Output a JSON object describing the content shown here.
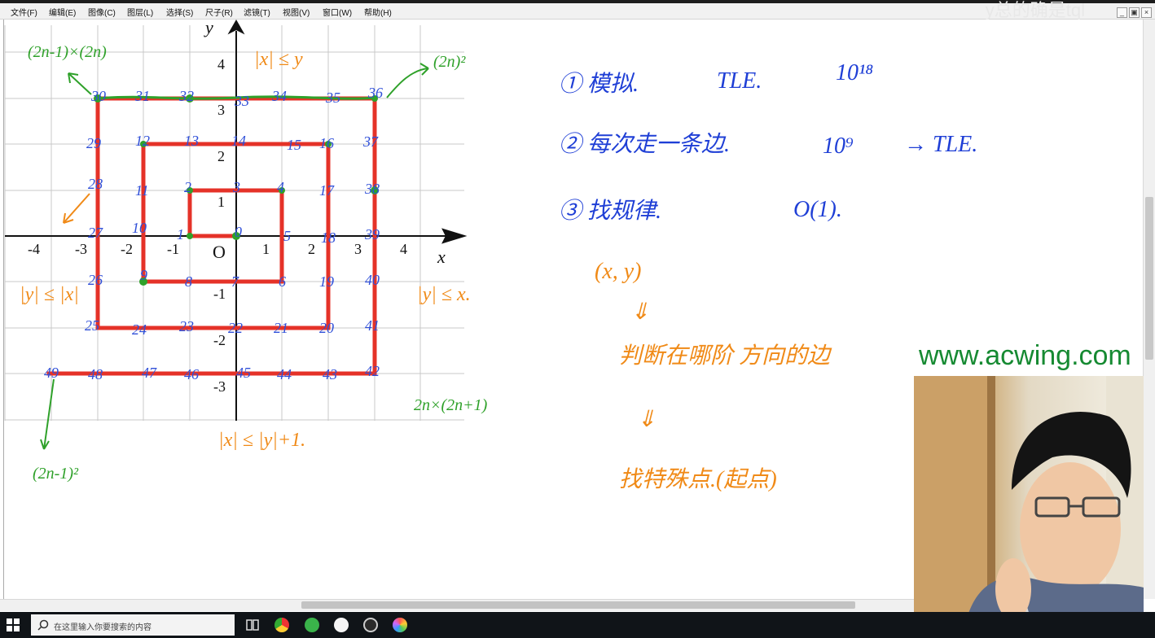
{
  "app": {
    "menu": [
      "文件(F)",
      "编辑(E)",
      "图像(C)",
      "图层(L)",
      "选择(S)",
      "尺子(R)",
      "滤镜(T)",
      "视图(V)",
      "窗口(W)",
      "帮助(H)"
    ],
    "user_overlay": "y总的确是tql",
    "window_buttons": [
      "_",
      "▣",
      "×"
    ]
  },
  "graph": {
    "x_axis_label": "x",
    "y_axis_label": "y",
    "origin_label": "O",
    "x_ticks": [
      "-4",
      "-3",
      "-2",
      "-1",
      "1",
      "2",
      "3",
      "4"
    ],
    "y_ticks": [
      "4",
      "3",
      "2",
      "1",
      "-1",
      "-2",
      "-3"
    ],
    "spiral_numbers": [
      "0",
      "1",
      "2",
      "3",
      "4",
      "5",
      "6",
      "7",
      "8",
      "9",
      "10",
      "11",
      "12",
      "13",
      "14",
      "15",
      "16",
      "17",
      "18",
      "19",
      "20",
      "21",
      "22",
      "23",
      "24",
      "25",
      "26",
      "27",
      "28",
      "29",
      "30",
      "31",
      "32",
      "33",
      "34",
      "35",
      "36",
      "37",
      "38",
      "39",
      "40",
      "41",
      "42",
      "43",
      "44",
      "45",
      "46",
      "47",
      "48",
      "49"
    ]
  },
  "annotations": {
    "green": [
      "(2n-1)×(2n)",
      "(2n)²",
      "2n×(2n+1)",
      "(2n-1)²"
    ],
    "orange": [
      "|x| ≤ y",
      "|y| ≤ |x|",
      "|y| ≤ x.",
      "|x| ≤ |y|+1."
    ],
    "blue_notes": [
      {
        "label": "① 模拟.",
        "complexity": "TLE.",
        "extra": "10¹⁸"
      },
      {
        "label": "② 每次走一条边.",
        "complexity": "10⁹",
        "extra": "→ TLE."
      },
      {
        "label": "③ 找规律.",
        "complexity": "O(1).",
        "extra": ""
      }
    ],
    "orange_notes": [
      "(x, y)",
      "⇓",
      "判断在哪阶 方向的边",
      "⇓",
      "找特殊点.(起点)"
    ]
  },
  "overlay": {
    "brand": "www.acwing.com"
  },
  "taskbar": {
    "search_placeholder": "在这里输入你要搜索的内容"
  },
  "colors": {
    "spiral": "#e53228",
    "numbers": "#2f4fd8",
    "green": "#2fa12a",
    "orange": "#f08a17",
    "blue_notes": "#1f3fd6",
    "brand": "#168a32"
  }
}
